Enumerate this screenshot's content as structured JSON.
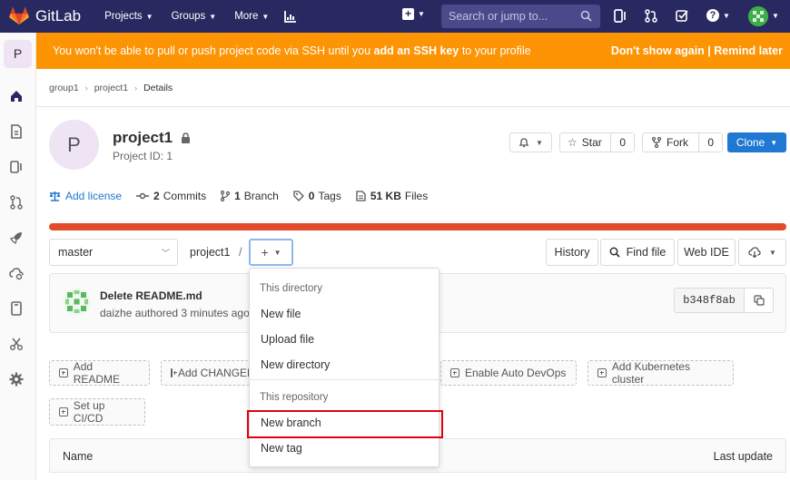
{
  "topbar": {
    "app_name": "GitLab",
    "nav": [
      {
        "label": "Projects"
      },
      {
        "label": "Groups"
      },
      {
        "label": "More"
      }
    ],
    "search_placeholder": "Search or jump to..."
  },
  "banner": {
    "message_pre": "You won't be able to pull or push project code via SSH until you ",
    "message_link": "add an SSH key",
    "message_post": " to your profile",
    "dismiss": "Don't show again",
    "separator": "|",
    "remind": "Remind later",
    "color": "#fc9403"
  },
  "sidebar": {
    "project_initial": "P"
  },
  "breadcrumb": {
    "items": [
      "group1",
      "project1",
      "Details"
    ]
  },
  "project": {
    "initial": "P",
    "name": "project1",
    "id_text": "Project ID: 1"
  },
  "actions": {
    "star_label": "Star",
    "star_count": "0",
    "fork_label": "Fork",
    "fork_count": "0",
    "clone_label": "Clone"
  },
  "stats": {
    "license": "Add license",
    "commits_count": "2",
    "commits_label": "Commits",
    "branch_count": "1",
    "branch_label": "Branch",
    "tags_count": "0",
    "tags_label": "Tags",
    "files_size": "51 KB",
    "files_label": "Files"
  },
  "repo": {
    "branch": "master",
    "path": "project1",
    "path_sep": "/",
    "history": "History",
    "find_file": "Find file",
    "web_ide": "Web IDE"
  },
  "commit": {
    "title": "Delete README.md",
    "meta": "daizhe authored 3 minutes ago",
    "sha": "b348f8ab"
  },
  "add_buttons": {
    "readme": "Add README",
    "changelog": "Add CHANGELOG",
    "auto_devops": "Enable Auto DevOps",
    "kubernetes": "Add Kubernetes cluster",
    "cicd": "Set up CI/CD"
  },
  "table": {
    "col_name": "Name",
    "col_update": "Last update"
  },
  "dropdown": {
    "header_directory": "This directory",
    "new_file": "New file",
    "upload_file": "Upload file",
    "new_directory": "New directory",
    "header_repository": "This repository",
    "new_branch": "New branch",
    "new_tag": "New tag"
  }
}
